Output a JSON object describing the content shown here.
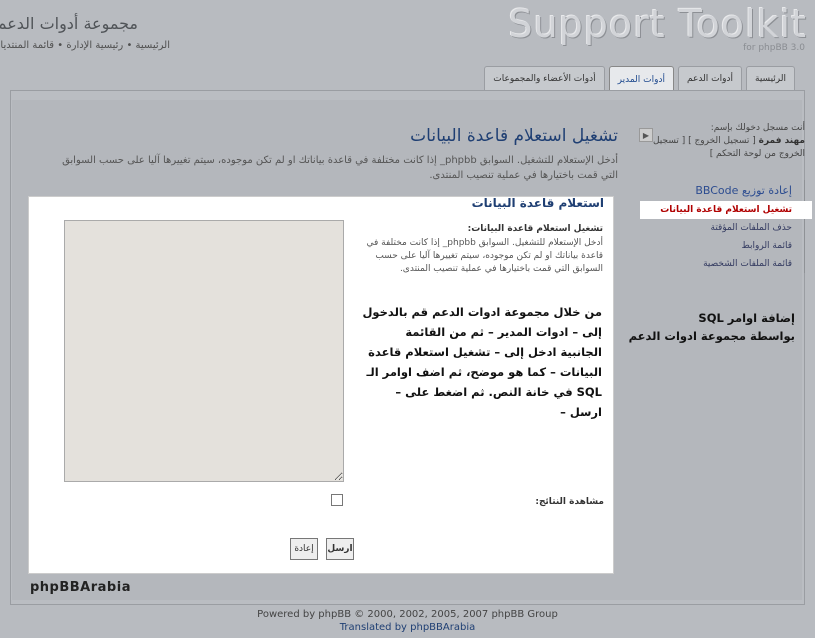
{
  "header": {
    "site_title": "مجموعة أدوات الدعم",
    "breadcrumb": [
      "الرئيسية",
      "رئيسية الإدارة",
      "قائمة المنتديات"
    ],
    "logo_text": "Support Toolkit",
    "logo_sub": "for phpBB 3.0"
  },
  "tabs": [
    {
      "label": "الرئيسية"
    },
    {
      "label": "أدوات الدعم"
    },
    {
      "label": "أدوات المدير"
    },
    {
      "label": "أدوات الأعضاء والمجموعات"
    }
  ],
  "main": {
    "title": "تشغيل استعلام قاعدة البيانات",
    "description": "أدخل الإستعلام للتشغيل. السوابق phpbb_ إذا كانت مختلفة في قاعدة بياناتك او لم تكن موجوده، سيتم تغييرها آليا على حسب السوابق التي قمت باختيارها في عملية تنصيب المنتدى."
  },
  "sidebar": {
    "login_prefix": "أنت مسجل دخولك بإسم:",
    "username": "مهند فمرة",
    "logout": "[ تسجيل الخروج ]",
    "acp_logout": "[ تسجيل الخروج من لوحة التحكم ]",
    "nav": [
      {
        "label": "إعادة توزيع BBCode"
      },
      {
        "label": "تشغيل استعلام قاعدة البيانات"
      },
      {
        "label": "حذف الملفات المؤقتة"
      },
      {
        "label": "قائمة الروابط"
      },
      {
        "label": "قائمة الملفات الشخصية"
      }
    ]
  },
  "dialog": {
    "title": "استعلام قاعدة البيانات",
    "field_label": "تشغيل استعلام قاعدة البيانات:",
    "field_desc": "أدخل الإستعلام للتشغيل. السوابق phpbb_ إذا كانت مختلفة في قاعدة بياناتك او لم تكن موجوده، سيتم تغييرها آليا على حسب السوابق التي قمت باختيارها في عملية تنصيب المنتدى.",
    "query_value": "",
    "instruction": "من خلال مجموعة ادوات الدعم قم بالدخول إلى – ادوات المدير – ثم من القائمة الجانبية ادخل إلى – تشغيل استعلام قاعدة البيانات – كما هو موضح، ثم اضف اوامر الـ SQL في خانة النص. ثم اضغط على – ارسل –",
    "results_label": "مشاهدة النتائج:",
    "results_checked": false,
    "submit_label": "ارسل",
    "reset_label": "إعادة"
  },
  "side_note": {
    "line1": "إضافة اوامر SQL",
    "line2": "بواسطة مجموعة ادوات الدعم"
  },
  "brand": "phpBBArabia",
  "footer": {
    "line1": "Powered by phpBB © 2000, 2002, 2005, 2007 phpBB Group",
    "line2": "Translated by phpBBArabia"
  }
}
